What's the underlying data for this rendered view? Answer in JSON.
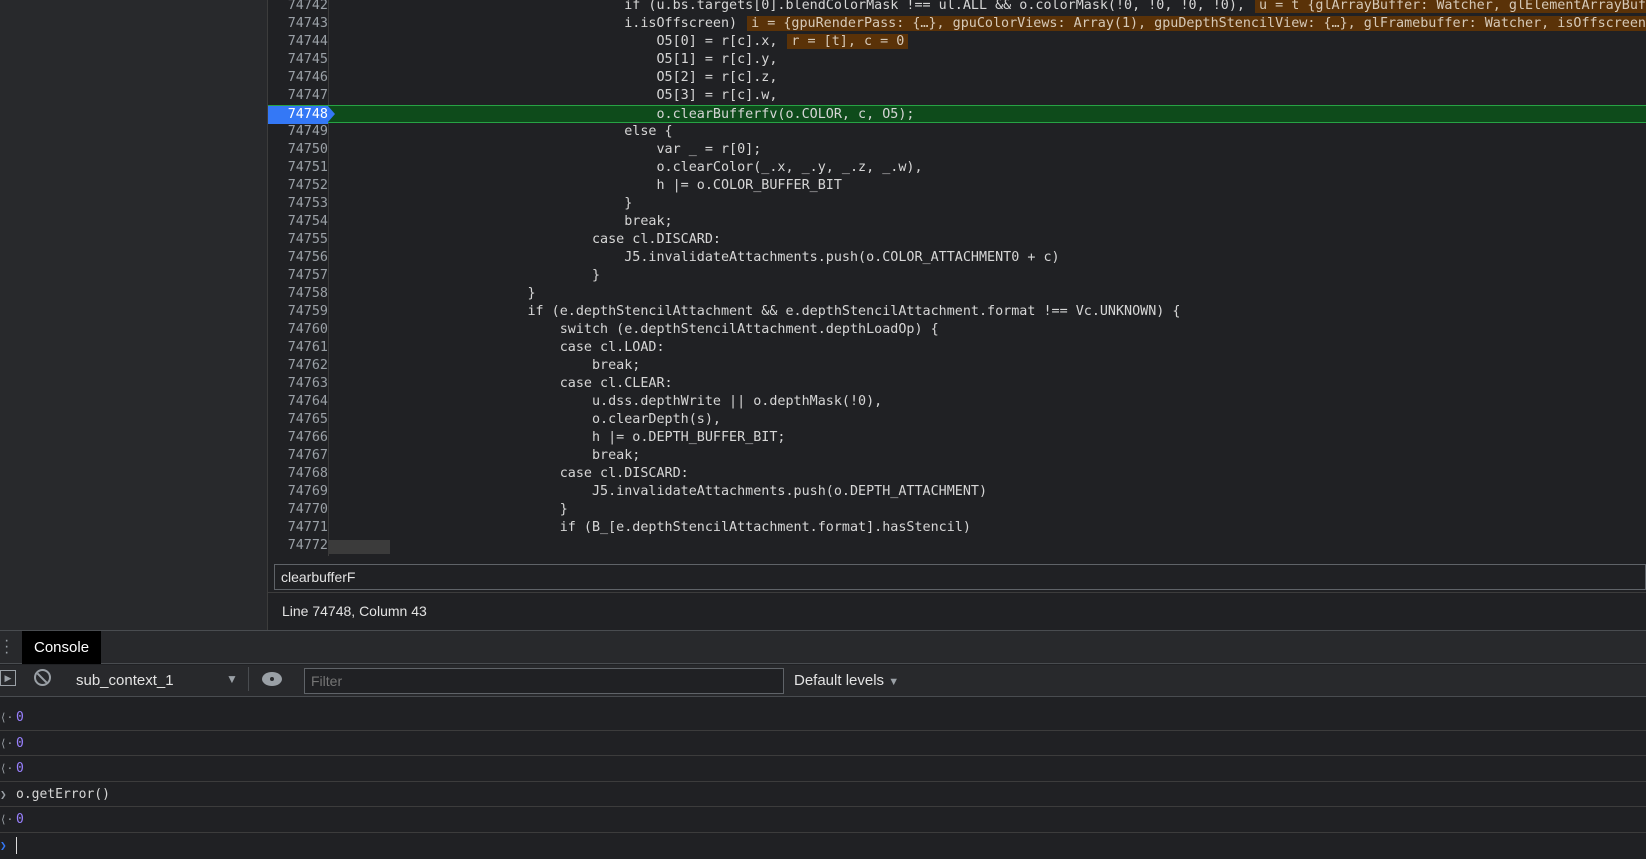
{
  "editor": {
    "current_line": "74748",
    "lines": [
      {
        "n": "74742",
        "code": "                                    if (u.bs.targets[0].blendColorMask !== ul.ALL && o.colorMask(!0, !0, !0, !0),",
        "inline": "u = t {glArrayBuffer: Watcher, glElementArrayBuffer"
      },
      {
        "n": "74743",
        "code": "                                    i.isOffscreen)",
        "inline": "i = {gpuRenderPass: {…}, gpuColorViews: Array(1), gpuDepthStencilView: {…}, glFramebuffer: Watcher, isOffscreen"
      },
      {
        "n": "74744",
        "code": "                                        O5[0] = r[c].x,",
        "inline": "r = [t], c = 0"
      },
      {
        "n": "74745",
        "code": "                                        O5[1] = r[c].y,"
      },
      {
        "n": "74746",
        "code": "                                        O5[2] = r[c].z,"
      },
      {
        "n": "74747",
        "code": "                                        O5[3] = r[c].w,"
      },
      {
        "n": "74748",
        "code": "                                        o.clearBufferfv(o.COLOR, c, O5);",
        "match": "clearBufferfv"
      },
      {
        "n": "74749",
        "code": "                                    else {"
      },
      {
        "n": "74750",
        "code": "                                        var _ = r[0];"
      },
      {
        "n": "74751",
        "code": "                                        o.clearColor(_.x, _.y, _.z, _.w),"
      },
      {
        "n": "74752",
        "code": "                                        h |= o.COLOR_BUFFER_BIT"
      },
      {
        "n": "74753",
        "code": "                                    }"
      },
      {
        "n": "74754",
        "code": "                                    break;"
      },
      {
        "n": "74755",
        "code": "                                case cl.DISCARD:"
      },
      {
        "n": "74756",
        "code": "                                    J5.invalidateAttachments.push(o.COLOR_ATTACHMENT0 + c)"
      },
      {
        "n": "74757",
        "code": "                                }"
      },
      {
        "n": "74758",
        "code": "                        }"
      },
      {
        "n": "74759",
        "code": "                        if (e.depthStencilAttachment && e.depthStencilAttachment.format !== Vc.UNKNOWN) {"
      },
      {
        "n": "74760",
        "code": "                            switch (e.depthStencilAttachment.depthLoadOp) {"
      },
      {
        "n": "74761",
        "code": "                            case cl.LOAD:"
      },
      {
        "n": "74762",
        "code": "                                break;"
      },
      {
        "n": "74763",
        "code": "                            case cl.CLEAR:"
      },
      {
        "n": "74764",
        "code": "                                u.dss.depthWrite || o.depthMask(!0),"
      },
      {
        "n": "74765",
        "code": "                                o.clearDepth(s),"
      },
      {
        "n": "74766",
        "code": "                                h |= o.DEPTH_BUFFER_BIT;"
      },
      {
        "n": "74767",
        "code": "                                break;"
      },
      {
        "n": "74768",
        "code": "                            case cl.DISCARD:"
      },
      {
        "n": "74769",
        "code": "                                J5.invalidateAttachments.push(o.DEPTH_ATTACHMENT)"
      },
      {
        "n": "74770",
        "code": "                            }"
      },
      {
        "n": "74771",
        "code": "                            if (B_[e.depthStencilAttachment.format].hasStencil)"
      },
      {
        "n": "74772",
        "code": ""
      }
    ]
  },
  "search": {
    "value": "clearbufferF"
  },
  "status": {
    "position": "Line 74748, Column 43"
  },
  "drawer": {
    "tab": "Console"
  },
  "console_toolbar": {
    "context": "sub_context_1",
    "filter_placeholder": "Filter",
    "levels": "Default levels"
  },
  "console": {
    "messages": [
      {
        "type": "result",
        "text": "0"
      },
      {
        "type": "result",
        "text": "0"
      },
      {
        "type": "result",
        "text": "0"
      },
      {
        "type": "input",
        "text": "o.getError()"
      },
      {
        "type": "result",
        "text": "0"
      }
    ]
  },
  "colors": {
    "current_line_bg": "#0e4b1b",
    "breakpoint": "#3478f6",
    "inline_value_bg": "#5a3208"
  }
}
